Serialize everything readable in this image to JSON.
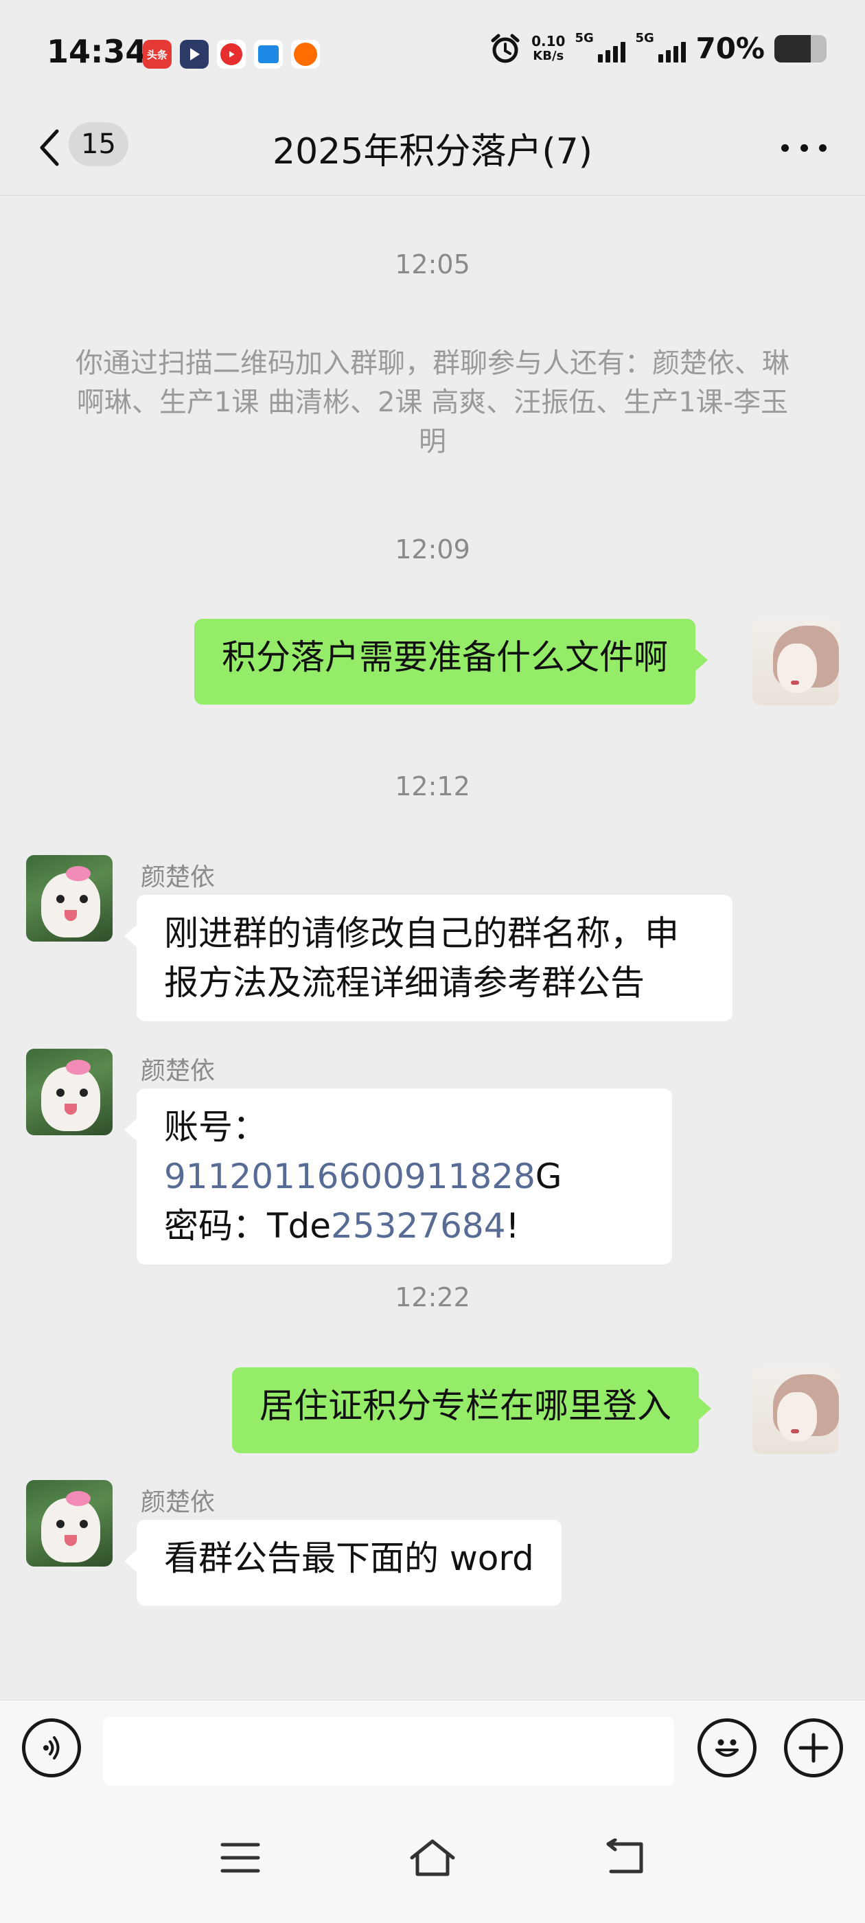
{
  "status_bar": {
    "time": "14:34",
    "apps": [
      {
        "name": "toutiao-icon",
        "label": "头条"
      },
      {
        "name": "play-app-icon",
        "label": ""
      },
      {
        "name": "video-app-icon",
        "label": ""
      },
      {
        "name": "square-app-icon",
        "label": ""
      },
      {
        "name": "round-app-icon",
        "label": ""
      }
    ],
    "net_speed_value": "0.10",
    "net_speed_unit": "KB/s",
    "signal1_label": "5G",
    "signal2_label": "5G",
    "battery_percent_text": "70%",
    "battery_level": 0.7
  },
  "header": {
    "unread_count": "15",
    "title": "2025年积分落户(7)"
  },
  "messages": {
    "t1": "12:05",
    "system": "你通过扫描二维码加入群聊，群聊参与人还有：颜楚依、琳啊琳、生产1课 曲清彬、2课  高爽、汪振伍、生产1课-李玉明",
    "t2": "12:09",
    "m1": "积分落户需要准备什么文件啊",
    "t3": "12:12",
    "m2_sender": "颜楚依",
    "m2_line1": "刚进群的请修改自己的群名称，申",
    "m2_line2": "报方法及流程详细请参考群公告",
    "m3_sender": "颜楚依",
    "m3_acct_label": "账号：",
    "m3_acct_link": "91120116600911828",
    "m3_acct_tail": "G",
    "m3_pwd_label": "密码：",
    "m3_pwd_head": "Tde",
    "m3_pwd_link": "25327684",
    "m3_pwd_tail": "!",
    "t4": "12:22",
    "m4": "居住证积分专栏在哪里登入",
    "m5_sender": "颜楚依",
    "m5": "看群公告最下面的 word"
  },
  "input_bar": {
    "value": "",
    "placeholder": ""
  },
  "colors": {
    "outgoing_bubble": "#95ec69",
    "incoming_bubble": "#ffffff",
    "link": "#576b95",
    "background": "#ededed"
  }
}
